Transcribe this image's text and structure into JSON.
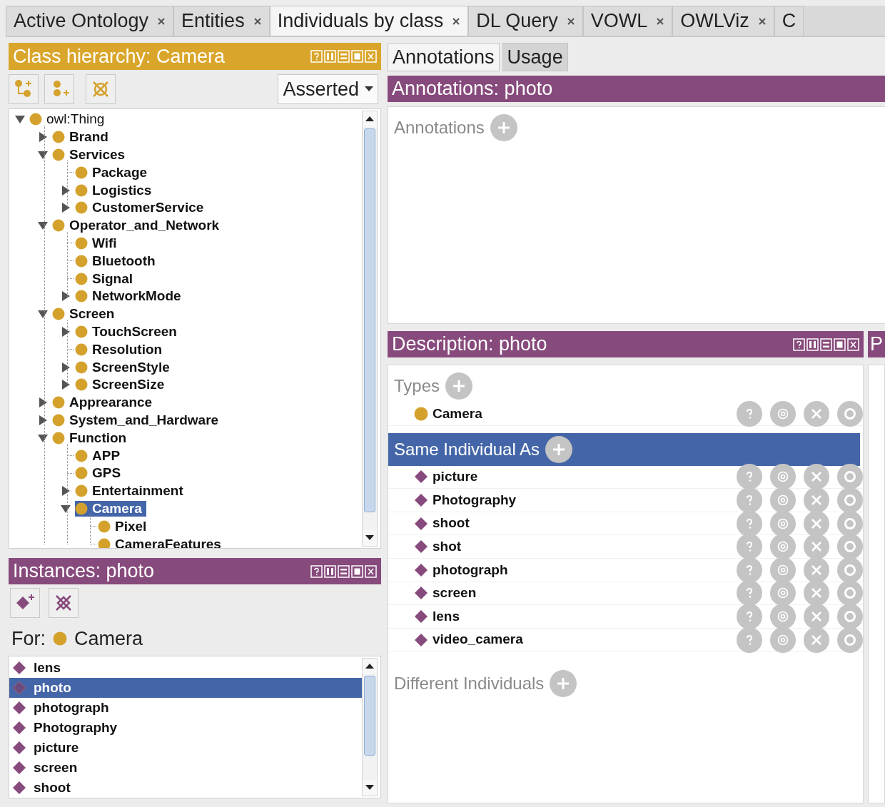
{
  "tabs": [
    {
      "label": "Active Ontology",
      "selected": false,
      "closable": true
    },
    {
      "label": "Entities",
      "selected": false,
      "closable": true
    },
    {
      "label": "Individuals by class",
      "selected": true,
      "closable": true
    },
    {
      "label": "DL Query",
      "selected": false,
      "closable": true
    },
    {
      "label": "VOWL",
      "selected": false,
      "closable": true
    },
    {
      "label": "OWLViz",
      "selected": false,
      "closable": true
    },
    {
      "label": "C",
      "selected": false,
      "closable": false
    }
  ],
  "class_hierarchy": {
    "title": "Class hierarchy: Camera",
    "view_mode": "Asserted",
    "tree": [
      {
        "label": "owl:Thing",
        "selected": false,
        "expanded": true,
        "children": [
          {
            "label": "Brand",
            "selected": false,
            "expanded": false
          },
          {
            "label": "Services",
            "selected": false,
            "expanded": true,
            "children": [
              {
                "label": "Package",
                "selected": false
              },
              {
                "label": "Logistics",
                "selected": false,
                "expanded": false
              },
              {
                "label": "CustomerService",
                "selected": false,
                "expanded": false
              }
            ]
          },
          {
            "label": "Operator_and_Network",
            "selected": false,
            "expanded": true,
            "children": [
              {
                "label": "Wifi",
                "selected": false
              },
              {
                "label": "Bluetooth",
                "selected": false
              },
              {
                "label": "Signal",
                "selected": false
              },
              {
                "label": "NetworkMode",
                "selected": false,
                "expanded": false
              }
            ]
          },
          {
            "label": "Screen",
            "selected": false,
            "expanded": true,
            "children": [
              {
                "label": "TouchScreen",
                "selected": false,
                "expanded": false
              },
              {
                "label": "Resolution",
                "selected": false
              },
              {
                "label": "ScreenStyle",
                "selected": false,
                "expanded": false
              },
              {
                "label": "ScreenSize",
                "selected": false,
                "expanded": false
              }
            ]
          },
          {
            "label": "Apprearance",
            "selected": false,
            "expanded": false
          },
          {
            "label": "System_and_Hardware",
            "selected": false,
            "expanded": false
          },
          {
            "label": "Function",
            "selected": false,
            "expanded": true,
            "children": [
              {
                "label": "APP",
                "selected": false
              },
              {
                "label": "GPS",
                "selected": false
              },
              {
                "label": "Entertainment",
                "selected": false,
                "expanded": false
              },
              {
                "label": "Camera",
                "selected": true,
                "expanded": true,
                "children": [
                  {
                    "label": "Pixel",
                    "selected": false
                  },
                  {
                    "label": "CameraFeatures",
                    "selected": false
                  }
                ]
              }
            ]
          }
        ]
      }
    ]
  },
  "instances": {
    "title": "Instances: photo",
    "for_label": "For:",
    "for_class": "Camera",
    "items": [
      {
        "label": "lens",
        "selected": false
      },
      {
        "label": "photo",
        "selected": true
      },
      {
        "label": "photograph",
        "selected": false
      },
      {
        "label": "Photography",
        "selected": false
      },
      {
        "label": "picture",
        "selected": false
      },
      {
        "label": "screen",
        "selected": false
      },
      {
        "label": "shoot",
        "selected": false
      }
    ]
  },
  "annotation_tabs": [
    {
      "label": "Annotations",
      "selected": true
    },
    {
      "label": "Usage",
      "selected": false
    }
  ],
  "annotations": {
    "title": "Annotations: photo",
    "section": "Annotations"
  },
  "description": {
    "title": "Description: photo",
    "sections": [
      {
        "title": "Types",
        "highlighted": false,
        "items": [
          {
            "label": "Camera",
            "kind": "class"
          }
        ]
      },
      {
        "title": "Same Individual As",
        "highlighted": true,
        "items": [
          {
            "label": "picture",
            "kind": "individual"
          },
          {
            "label": "Photography",
            "kind": "individual"
          },
          {
            "label": "shoot",
            "kind": "individual"
          },
          {
            "label": "shot",
            "kind": "individual"
          },
          {
            "label": "photograph",
            "kind": "individual"
          },
          {
            "label": "screen",
            "kind": "individual"
          },
          {
            "label": "lens",
            "kind": "individual"
          },
          {
            "label": "video_camera",
            "kind": "individual"
          }
        ]
      },
      {
        "title": "Different Individuals",
        "highlighted": false
      }
    ]
  },
  "side_panel": {
    "title": "P"
  }
}
